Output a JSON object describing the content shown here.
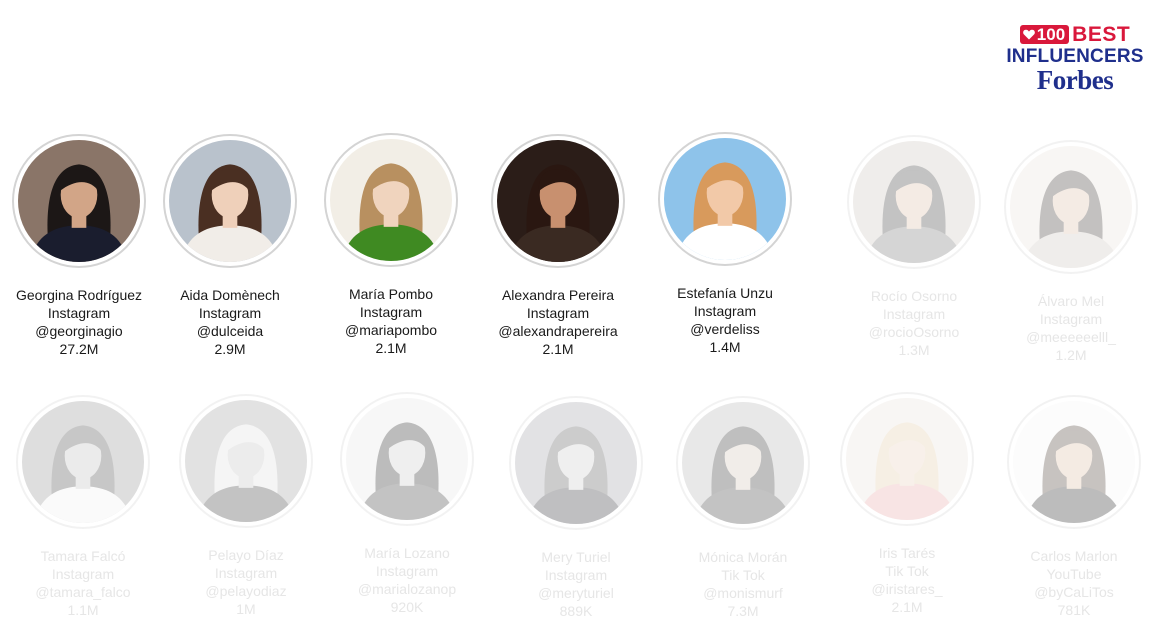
{
  "logo": {
    "count": "100",
    "top": "BEST",
    "middle": "INFLUENCERS",
    "brand": "Forbes"
  },
  "influencers": [
    {
      "name": "Georgina Rodríguez",
      "platform": "Instagram",
      "handle": "@georginagio",
      "followers": "27.2M",
      "highlighted": true,
      "bg": "#8a7568",
      "hair": "#1c1716",
      "skin": "#d2a587",
      "cloth": "#1a1d2e"
    },
    {
      "name": "Aida Domènech",
      "platform": "Instagram",
      "handle": "@dulceida",
      "followers": "2.9M",
      "highlighted": true,
      "bg": "#b9c2cc",
      "hair": "#4a2f22",
      "skin": "#efd0ba",
      "cloth": "#f1ede8"
    },
    {
      "name": "María Pombo",
      "platform": "Instagram",
      "handle": "@mariapombo",
      "followers": "2.1M",
      "highlighted": true,
      "bg": "#f2eee6",
      "hair": "#b89060",
      "skin": "#f0d4be",
      "cloth": "#3f8a22"
    },
    {
      "name": "Alexandra Pereira",
      "platform": "Instagram",
      "handle": "@alexandrapereira",
      "followers": "2.1M",
      "highlighted": true,
      "bg": "#2b1d18",
      "hair": "#2a1711",
      "skin": "#c8906f",
      "cloth": "#3a2a22"
    },
    {
      "name": "Estefanía Unzu",
      "platform": "Instagram",
      "handle": "@verdeliss",
      "followers": "1.4M",
      "highlighted": true,
      "bg": "#8ec3ea",
      "hair": "#d89a5c",
      "skin": "#f2c9a8",
      "cloth": "#ffffff"
    },
    {
      "name": "Rocío Osorno",
      "platform": "Instagram",
      "handle": "@rocioOsorno",
      "followers": "1.3M",
      "highlighted": false,
      "bg": "#c9c1b8",
      "hair": "#2a2a2a",
      "skin": "#d9b8a0",
      "cloth": "#6b6b6b"
    },
    {
      "name": "Álvaro Mel",
      "platform": "Instagram",
      "handle": "@meeeeeelll_",
      "followers": "1.2M",
      "highlighted": false,
      "bg": "#e8e0d8",
      "hair": "#2b2320",
      "skin": "#d8b8a0",
      "cloth": "#c8c0b8"
    },
    {
      "name": "Tamara Falcó",
      "platform": "Instagram",
      "handle": "@tamara_falco",
      "followers": "1.1M",
      "highlighted": false,
      "bg": "#8a8a8a",
      "hair": "#3a3a3a",
      "skin": "#b8b8b8",
      "cloth": "#f0f0f0"
    },
    {
      "name": "Pelayo Díaz",
      "platform": "Instagram",
      "handle": "@pelayodiaz",
      "followers": "1M",
      "highlighted": false,
      "bg": "#9a9a9a",
      "hair": "#dcdcdc",
      "skin": "#bdbdbd",
      "cloth": "#2a2a2a"
    },
    {
      "name": "María Lozano",
      "platform": "Instagram",
      "handle": "@marialozanop",
      "followers": "920K",
      "highlighted": false,
      "bg": "#e6e6e6",
      "hair": "#141414",
      "skin": "#c9c9c9",
      "cloth": "#2a2a2a"
    },
    {
      "name": "Mery Turiel",
      "platform": "Instagram",
      "handle": "@meryturiel",
      "followers": "889K",
      "highlighted": false,
      "bg": "#9a9aa2",
      "hair": "#4a4a4a",
      "skin": "#c8c8c8",
      "cloth": "#1e1e24"
    },
    {
      "name": "Mónica Morán",
      "platform": "Tik Tok",
      "handle": "@monismurf",
      "followers": "7.3M",
      "highlighted": false,
      "bg": "#b0b0b0",
      "hair": "#1e1e1e",
      "skin": "#d0c0b4",
      "cloth": "#2a2a2a"
    },
    {
      "name": "Iris Tarés",
      "platform": "Tik Tok",
      "handle": "@iristares_",
      "followers": "2.1M",
      "highlighted": false,
      "bg": "#e8e0d8",
      "hair": "#e0c8a0",
      "skin": "#e8cdb6",
      "cloth": "#e8a0a0"
    },
    {
      "name": "Carlos Marlon",
      "platform": "YouTube",
      "handle": "@byCaLiTos",
      "followers": "781K",
      "highlighted": false,
      "bg": "#f6f6f6",
      "hair": "#3a2a22",
      "skin": "#d9b89c",
      "cloth": "#141414"
    }
  ]
}
